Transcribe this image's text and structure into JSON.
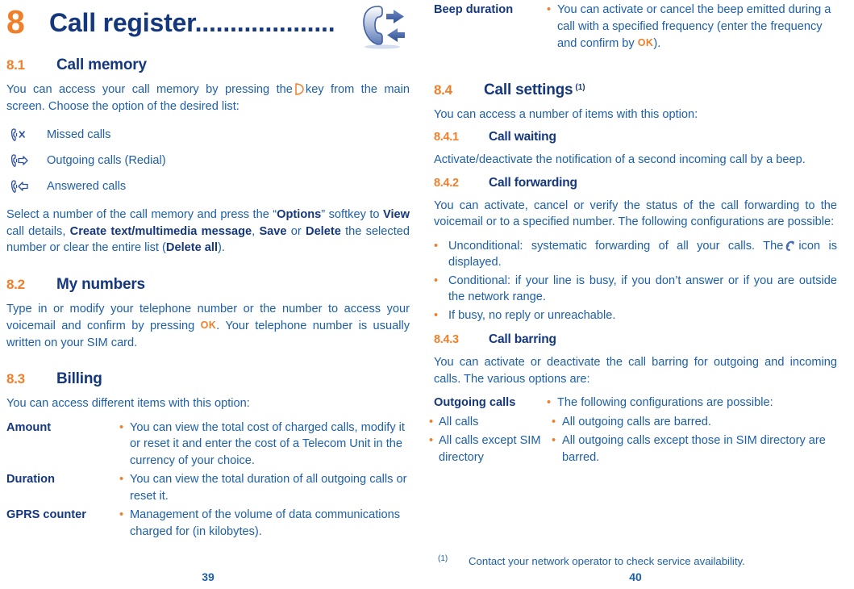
{
  "colors": {
    "accent_orange": "#f07f29",
    "heading_navy": "#14377d",
    "body_blue": "#1d5fa8"
  },
  "chapter": {
    "number": "8",
    "title": "Call register....................",
    "icon": "call-register-icon"
  },
  "left_column": {
    "section_8_1": {
      "num": "8.1",
      "title": "Call memory",
      "intro_part1": "You can access your call memory by pressing the",
      "intro_key_icon": "call-key-icon",
      "intro_part2": "key from the main screen. Choose the option of the desired list:",
      "icon_list": [
        {
          "icon": "missed-calls-icon",
          "label": "Missed calls"
        },
        {
          "icon": "outgoing-calls-icon",
          "label": "Outgoing calls (Redial)"
        },
        {
          "icon": "answered-calls-icon",
          "label": "Answered calls"
        }
      ],
      "outro": {
        "t1": "Select a number of the call memory and press the “",
        "b1": "Options",
        "t2": "” softkey to ",
        "b2": "View",
        "t3": " call details, ",
        "b3": "Create text/multimedia message",
        "t4": ", ",
        "b4": "Save",
        "t5": " or ",
        "b5": "Delete",
        "t6": " the selected number or clear the entire list (",
        "b6": "Delete all",
        "t7": ")."
      }
    },
    "section_8_2": {
      "num": "8.2",
      "title": "My numbers",
      "body_part1": "Type in or modify your telephone number or the number to access your voicemail and confirm by pressing",
      "ok_key": "OK",
      "body_part2": ". Your telephone number is usually written on your SIM card."
    },
    "section_8_3": {
      "num": "8.3",
      "title": "Billing",
      "intro": "You can access different items with this option:",
      "rows": [
        {
          "term": "Amount",
          "bullet": "•",
          "desc": "You can view the total cost of charged calls, modify it or reset it and enter the cost of a Telecom Unit in the currency of your choice."
        },
        {
          "term": "Duration",
          "bullet": "•",
          "desc": "You can view the total duration of all outgoing calls or reset it."
        },
        {
          "term": "GPRS counter",
          "bullet": "•",
          "desc": "Management of the volume of data communications charged for (in kilobytes)."
        }
      ]
    },
    "page_number": "39"
  },
  "right_column": {
    "beep_row": {
      "term": "Beep duration",
      "bullet": "•",
      "desc_part1": "You can activate or cancel the beep emitted during a call with a specified frequency (enter the frequency and confirm by",
      "ok_key": "OK",
      "desc_part2": ")."
    },
    "section_8_4": {
      "num": "8.4",
      "title": "Call settings",
      "superscript": "(1)",
      "intro": "You can access a number of items with this option:",
      "sub_8_4_1": {
        "num": "8.4.1",
        "title": "Call waiting",
        "body": "Activate/deactivate the notification of a second incoming call by a beep."
      },
      "sub_8_4_2": {
        "num": "8.4.2",
        "title": "Call forwarding",
        "body": "You can activate, cancel or verify the status of the call forwarding to the voicemail or to a specified number. The following configurations are possible:",
        "bullets": [
          {
            "bullet": "•",
            "text_part1": "Unconditional: systematic forwarding of all your calls. The",
            "icon": "call-forwarding-icon",
            "text_part2": "icon is displayed."
          },
          {
            "bullet": "•",
            "text_part1": "Conditional: if your line is busy, if you don’t answer or if you are outside the network range.",
            "icon": "",
            "text_part2": ""
          },
          {
            "bullet": "•",
            "text_part1": "If busy, no reply or unreachable.",
            "icon": "",
            "text_part2": ""
          }
        ]
      },
      "sub_8_4_3": {
        "num": "8.4.3",
        "title": "Call barring",
        "body": "You can activate or deactivate the call barring for outgoing and incoming calls. The various options are:",
        "rows": [
          {
            "term": "Outgoing calls",
            "term_is_bold": true,
            "term_bullet": "",
            "bullet": "•",
            "desc": "The following configurations are possible:"
          },
          {
            "term": "All calls",
            "term_is_bold": false,
            "term_bullet": "•",
            "bullet": "•",
            "desc": "All outgoing calls are barred."
          },
          {
            "term": "All calls except SIM directory",
            "term_is_bold": false,
            "term_bullet": "•",
            "bullet": "•",
            "desc": "All outgoing calls except those in SIM directory are barred."
          }
        ]
      }
    },
    "footnote": {
      "marker": "(1)",
      "text": "Contact your network operator to check service availability."
    },
    "page_number": "40"
  }
}
